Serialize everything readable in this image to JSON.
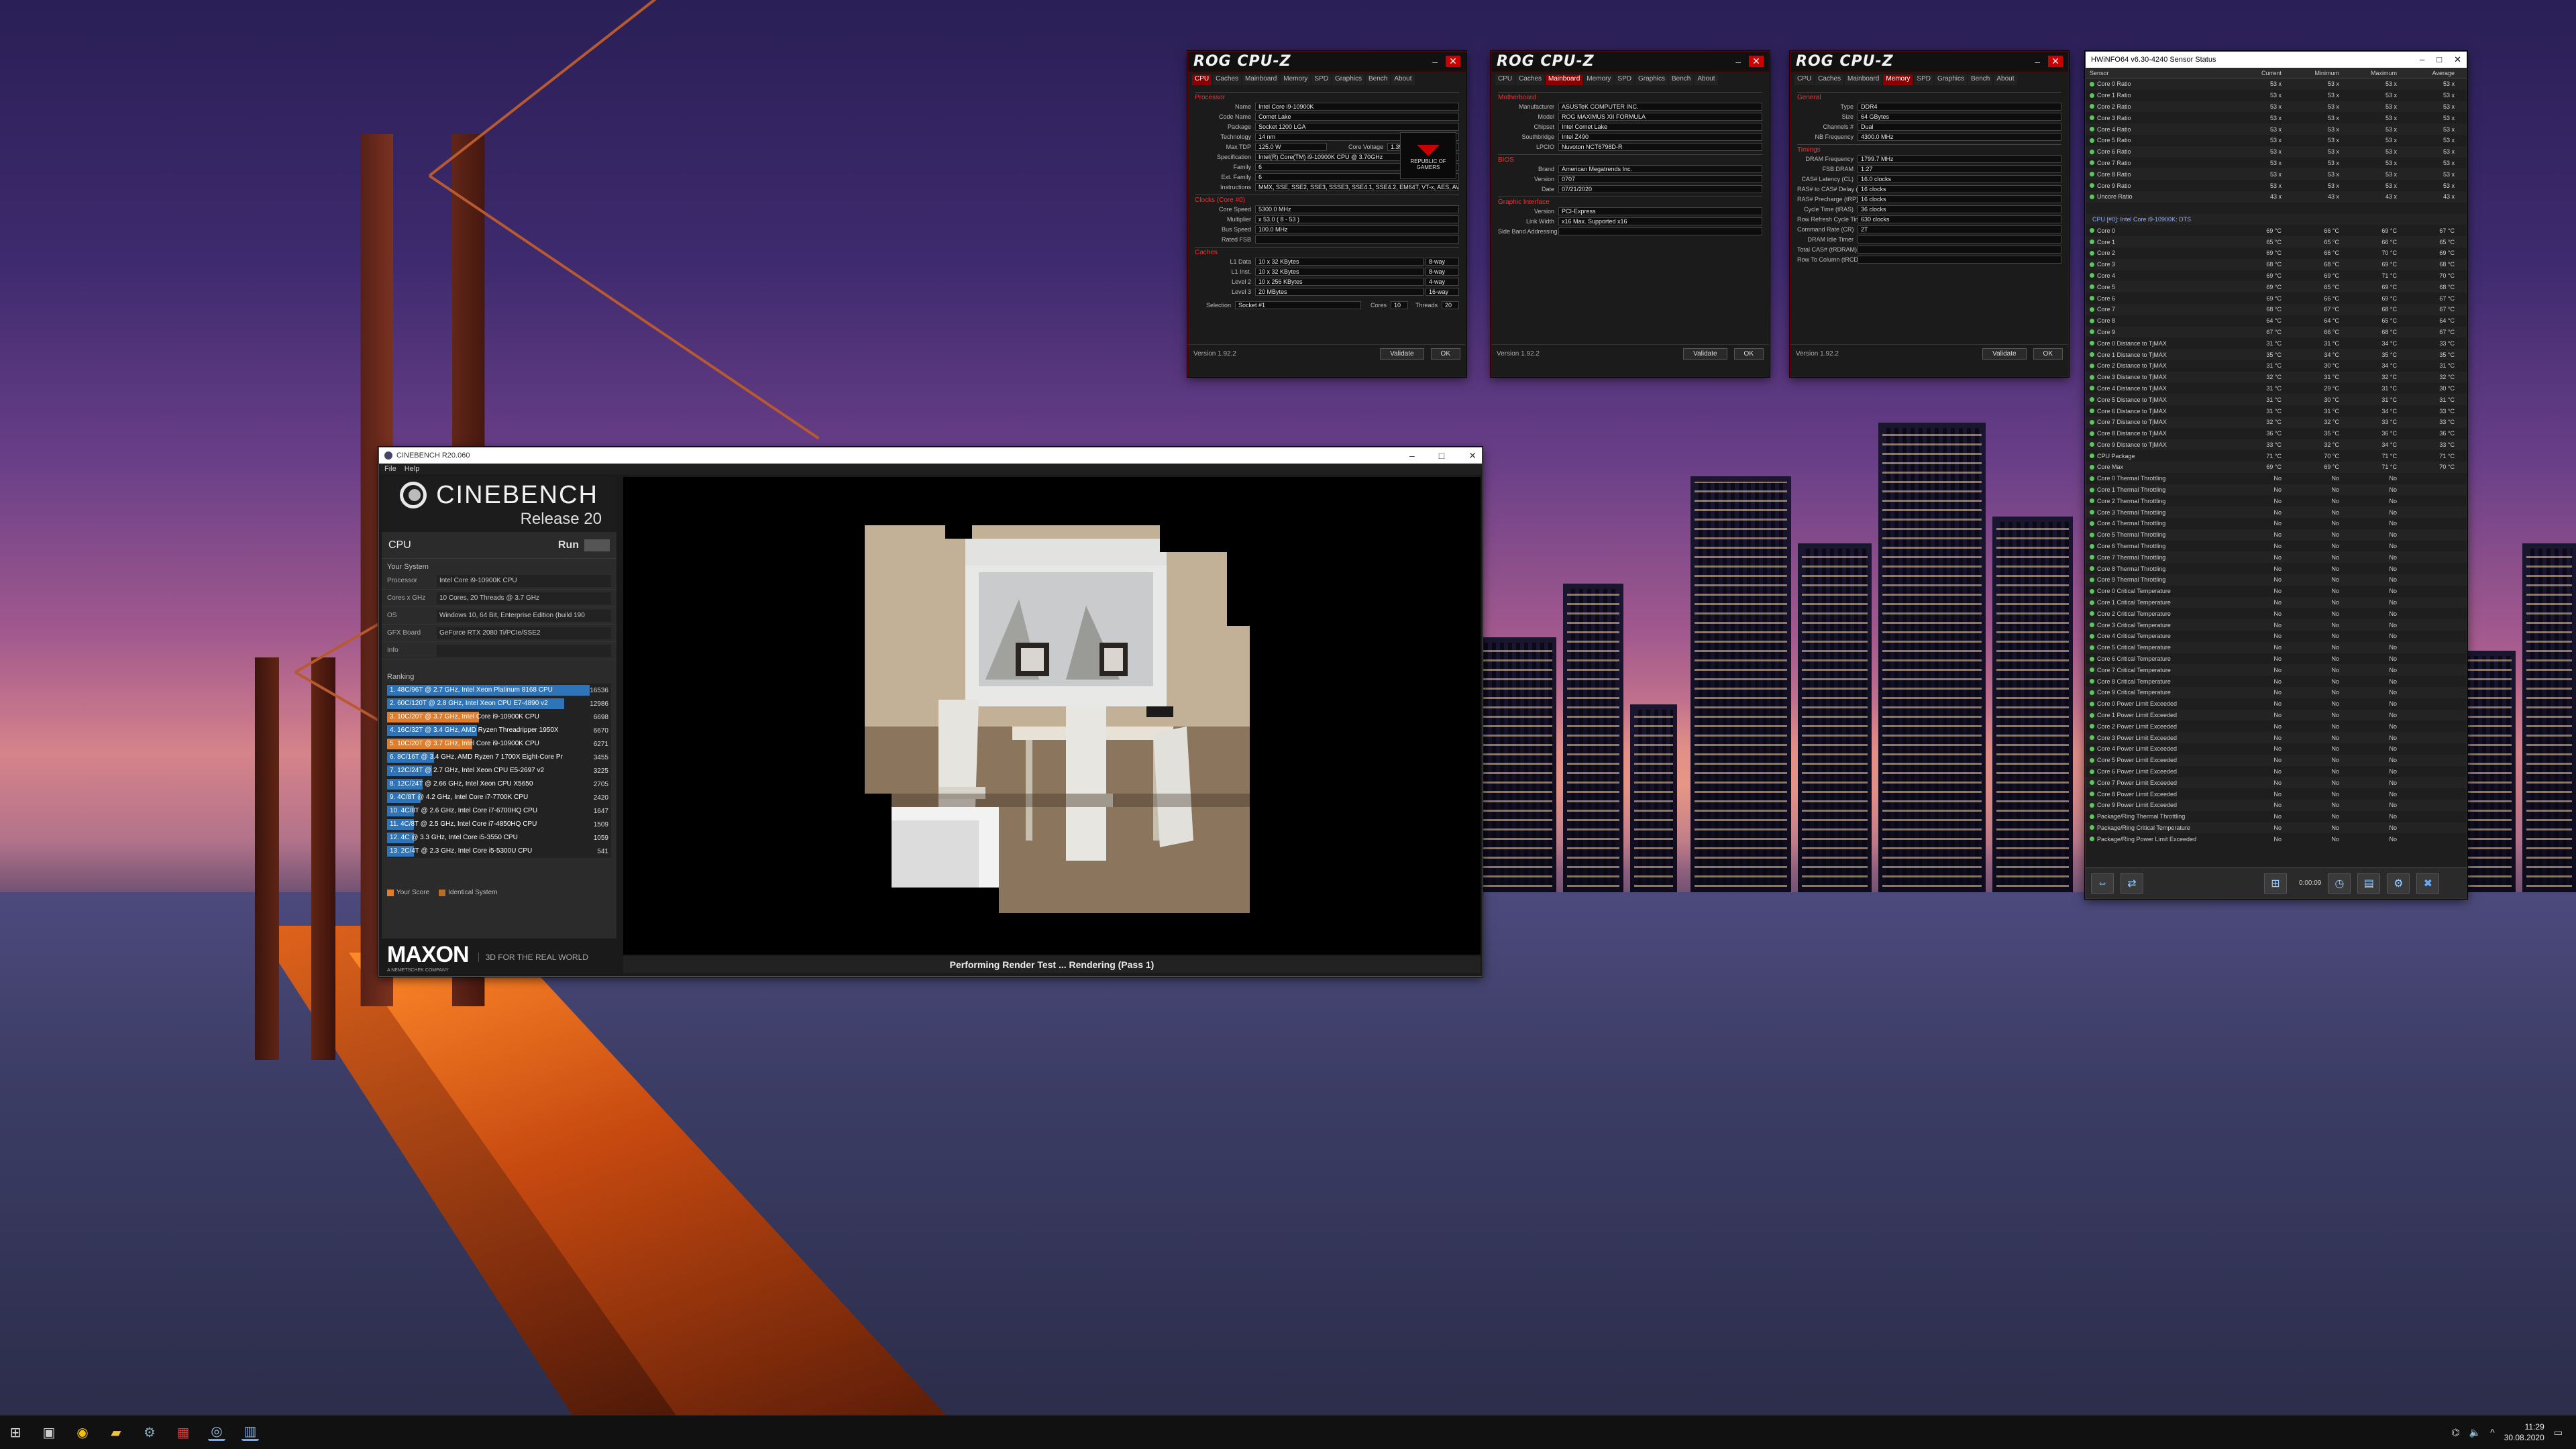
{
  "cpuz_windows": [
    {
      "logo": "ROG CPU-Z",
      "active_tab": "CPU",
      "tabs": [
        "CPU",
        "Caches",
        "Mainboard",
        "Memory",
        "SPD",
        "Graphics",
        "Bench",
        "About"
      ],
      "sections": [
        {
          "title": "Processor",
          "rows": [
            [
              "Name",
              "Intel Core i9-10900K"
            ],
            [
              "Code Name",
              "Comet Lake"
            ],
            [
              "Package",
              "Socket 1200 LGA"
            ],
            [
              "Technology",
              "14 nm"
            ],
            [
              "Specification",
              "Intel(R) Core(TM) i9-10900K CPU @ 3.70GHz"
            ],
            [
              "Family",
              "6"
            ],
            [
              "Ext. Family",
              "6"
            ],
            [
              "Instructions",
              "MMX, SSE, SSE2, SSE3, SSSE3, SSE4.1, SSE4.2, EM64T, VT-x, AES, AVX, AVX2, FMA3"
            ]
          ]
        },
        {
          "title": "Clocks (Core #0)",
          "rows": [
            [
              "Core Speed",
              "5300.0 MHz"
            ],
            [
              "Multiplier",
              "x 53.0 ( 8 - 53 )"
            ],
            [
              "Bus Speed",
              "100.0 MHz"
            ],
            [
              "Rated FSB",
              ""
            ]
          ]
        }
      ],
      "extra": {
        "max_tdp_label": "Max TDP",
        "max_tdp": "125.0 W",
        "core_voltage_label": "Core Voltage",
        "core_voltage": "1.352 V",
        "cache_label": "Caches",
        "cache_rows": [
          [
            "L1 Data",
            "10 x 32 KBytes",
            "8-way"
          ],
          [
            "L1 Inst.",
            "10 x 32 KBytes",
            "8-way"
          ],
          [
            "Level 2",
            "10 x 256 KBytes",
            "4-way"
          ],
          [
            "Level 3",
            "20 MBytes",
            "16-way"
          ]
        ],
        "selection_label": "Selection",
        "selection": "Socket #1",
        "cores_label": "Cores",
        "cores": "10",
        "threads_label": "Threads",
        "threads": "20",
        "badge": "REPUBLIC OF GAMERS"
      },
      "version": "Version 1.92.2",
      "validate": "Validate",
      "ok": "OK"
    },
    {
      "logo": "ROG CPU-Z",
      "active_tab": "Mainboard",
      "tabs": [
        "CPU",
        "Caches",
        "Mainboard",
        "Memory",
        "SPD",
        "Graphics",
        "Bench",
        "About"
      ],
      "sections": [
        {
          "title": "Motherboard",
          "rows": [
            [
              "Manufacturer",
              "ASUSTeK COMPUTER INC."
            ],
            [
              "Model",
              "ROG MAXIMUS XII FORMULA"
            ],
            [
              "Chipset",
              "Intel  Comet Lake"
            ],
            [
              "Southbridge",
              "Intel  Z490"
            ],
            [
              "LPCIO",
              "Nuvoton  NCT6798D-R"
            ]
          ]
        },
        {
          "title": "BIOS",
          "rows": [
            [
              "Brand",
              "American Megatrends Inc."
            ],
            [
              "Version",
              "0707"
            ],
            [
              "Date",
              "07/21/2020"
            ]
          ]
        },
        {
          "title": "Graphic Interface",
          "rows": [
            [
              "Version",
              "PCI-Express"
            ],
            [
              "Link Width",
              "x16   Max. Supported  x16"
            ],
            [
              "Side Band Addressing",
              ""
            ]
          ]
        }
      ],
      "version": "Version 1.92.2",
      "validate": "Validate",
      "ok": "OK"
    },
    {
      "logo": "ROG CPU-Z",
      "active_tab": "Memory",
      "tabs": [
        "CPU",
        "Caches",
        "Mainboard",
        "Memory",
        "SPD",
        "Graphics",
        "Bench",
        "About"
      ],
      "sections": [
        {
          "title": "General",
          "rows": [
            [
              "Type",
              "DDR4"
            ],
            [
              "Size",
              "64 GBytes"
            ],
            [
              "Channels #",
              "Dual"
            ],
            [
              "NB Frequency",
              "4300.0 MHz"
            ]
          ]
        },
        {
          "title": "Timings",
          "rows": [
            [
              "DRAM Frequency",
              "1799.7 MHz"
            ],
            [
              "FSB:DRAM",
              "1:27"
            ],
            [
              "CAS# Latency (CL)",
              "16.0 clocks"
            ],
            [
              "RAS# to CAS# Delay (tRCD)",
              "16 clocks"
            ],
            [
              "RAS# Precharge (tRP)",
              "16 clocks"
            ],
            [
              "Cycle Time (tRAS)",
              "36 clocks"
            ],
            [
              "Row Refresh Cycle Time (tRFC)",
              "630 clocks"
            ],
            [
              "Command Rate (CR)",
              "2T"
            ],
            [
              "DRAM Idle Timer",
              ""
            ],
            [
              "Total CAS# (tRDRAM)",
              ""
            ],
            [
              "Row To Column (tRCD)",
              ""
            ]
          ]
        }
      ],
      "version": "Version 1.92.2",
      "validate": "Validate",
      "ok": "OK"
    }
  ],
  "hwinfo": {
    "title": "HWiNFO64 v6.30-4240 Sensor Status",
    "columns": [
      "Sensor",
      "Current",
      "Minimum",
      "Maximum",
      "Average"
    ],
    "group_label": "CPU [#0]: Intel Core i9-10900K: DTS",
    "ratios": [
      [
        "Core 0 Ratio",
        "53 x",
        "53 x",
        "53 x",
        "53 x"
      ],
      [
        "Core 1 Ratio",
        "53 x",
        "53 x",
        "53 x",
        "53 x"
      ],
      [
        "Core 2 Ratio",
        "53 x",
        "53 x",
        "53 x",
        "53 x"
      ],
      [
        "Core 3 Ratio",
        "53 x",
        "53 x",
        "53 x",
        "53 x"
      ],
      [
        "Core 4 Ratio",
        "53 x",
        "53 x",
        "53 x",
        "53 x"
      ],
      [
        "Core 5 Ratio",
        "53 x",
        "53 x",
        "53 x",
        "53 x"
      ],
      [
        "Core 6 Ratio",
        "53 x",
        "53 x",
        "53 x",
        "53 x"
      ],
      [
        "Core 7 Ratio",
        "53 x",
        "53 x",
        "53 x",
        "53 x"
      ],
      [
        "Core 8 Ratio",
        "53 x",
        "53 x",
        "53 x",
        "53 x"
      ],
      [
        "Core 9 Ratio",
        "53 x",
        "53 x",
        "53 x",
        "53 x"
      ],
      [
        "Uncore Ratio",
        "43 x",
        "43 x",
        "43 x",
        "43 x"
      ]
    ],
    "temps": [
      [
        "Core 0",
        "69 °C",
        "66 °C",
        "69 °C",
        "67 °C"
      ],
      [
        "Core 1",
        "65 °C",
        "65 °C",
        "66 °C",
        "65 °C"
      ],
      [
        "Core 2",
        "69 °C",
        "66 °C",
        "70 °C",
        "69 °C"
      ],
      [
        "Core 3",
        "68 °C",
        "68 °C",
        "69 °C",
        "68 °C"
      ],
      [
        "Core 4",
        "69 °C",
        "69 °C",
        "71 °C",
        "70 °C"
      ],
      [
        "Core 5",
        "69 °C",
        "65 °C",
        "69 °C",
        "68 °C"
      ],
      [
        "Core 6",
        "69 °C",
        "66 °C",
        "69 °C",
        "67 °C"
      ],
      [
        "Core 7",
        "68 °C",
        "67 °C",
        "68 °C",
        "67 °C"
      ],
      [
        "Core 8",
        "64 °C",
        "64 °C",
        "65 °C",
        "64 °C"
      ],
      [
        "Core 9",
        "67 °C",
        "66 °C",
        "68 °C",
        "67 °C"
      ],
      [
        "Core 0 Distance to TjMAX",
        "31 °C",
        "31 °C",
        "34 °C",
        "33 °C"
      ],
      [
        "Core 1 Distance to TjMAX",
        "35 °C",
        "34 °C",
        "35 °C",
        "35 °C"
      ],
      [
        "Core 2 Distance to TjMAX",
        "31 °C",
        "30 °C",
        "34 °C",
        "31 °C"
      ],
      [
        "Core 3 Distance to TjMAX",
        "32 °C",
        "31 °C",
        "32 °C",
        "32 °C"
      ],
      [
        "Core 4 Distance to TjMAX",
        "31 °C",
        "29 °C",
        "31 °C",
        "30 °C"
      ],
      [
        "Core 5 Distance to TjMAX",
        "31 °C",
        "30 °C",
        "31 °C",
        "31 °C"
      ],
      [
        "Core 6 Distance to TjMAX",
        "31 °C",
        "31 °C",
        "34 °C",
        "33 °C"
      ],
      [
        "Core 7 Distance to TjMAX",
        "32 °C",
        "32 °C",
        "33 °C",
        "33 °C"
      ],
      [
        "Core 8 Distance to TjMAX",
        "36 °C",
        "35 °C",
        "36 °C",
        "36 °C"
      ],
      [
        "Core 9 Distance to TjMAX",
        "33 °C",
        "32 °C",
        "34 °C",
        "33 °C"
      ],
      [
        "CPU Package",
        "71 °C",
        "70 °C",
        "71 °C",
        "71 °C"
      ],
      [
        "Core Max",
        "69 °C",
        "69 °C",
        "71 °C",
        "70 °C"
      ]
    ],
    "flags": [
      [
        "Core 0 Thermal Throttling",
        "No",
        "No",
        "No"
      ],
      [
        "Core 1 Thermal Throttling",
        "No",
        "No",
        "No"
      ],
      [
        "Core 2 Thermal Throttling",
        "No",
        "No",
        "No"
      ],
      [
        "Core 3 Thermal Throttling",
        "No",
        "No",
        "No"
      ],
      [
        "Core 4 Thermal Throttling",
        "No",
        "No",
        "No"
      ],
      [
        "Core 5 Thermal Throttling",
        "No",
        "No",
        "No"
      ],
      [
        "Core 6 Thermal Throttling",
        "No",
        "No",
        "No"
      ],
      [
        "Core 7 Thermal Throttling",
        "No",
        "No",
        "No"
      ],
      [
        "Core 8 Thermal Throttling",
        "No",
        "No",
        "No"
      ],
      [
        "Core 9 Thermal Throttling",
        "No",
        "No",
        "No"
      ],
      [
        "Core 0 Critical Temperature",
        "No",
        "No",
        "No"
      ],
      [
        "Core 1 Critical Temperature",
        "No",
        "No",
        "No"
      ],
      [
        "Core 2 Critical Temperature",
        "No",
        "No",
        "No"
      ],
      [
        "Core 3 Critical Temperature",
        "No",
        "No",
        "No"
      ],
      [
        "Core 4 Critical Temperature",
        "No",
        "No",
        "No"
      ],
      [
        "Core 5 Critical Temperature",
        "No",
        "No",
        "No"
      ],
      [
        "Core 6 Critical Temperature",
        "No",
        "No",
        "No"
      ],
      [
        "Core 7 Critical Temperature",
        "No",
        "No",
        "No"
      ],
      [
        "Core 8 Critical Temperature",
        "No",
        "No",
        "No"
      ],
      [
        "Core 9 Critical Temperature",
        "No",
        "No",
        "No"
      ],
      [
        "Core 0 Power Limit Exceeded",
        "No",
        "No",
        "No"
      ],
      [
        "Core 1 Power Limit Exceeded",
        "No",
        "No",
        "No"
      ],
      [
        "Core 2 Power Limit Exceeded",
        "No",
        "No",
        "No"
      ],
      [
        "Core 3 Power Limit Exceeded",
        "No",
        "No",
        "No"
      ],
      [
        "Core 4 Power Limit Exceeded",
        "No",
        "No",
        "No"
      ],
      [
        "Core 5 Power Limit Exceeded",
        "No",
        "No",
        "No"
      ],
      [
        "Core 6 Power Limit Exceeded",
        "No",
        "No",
        "No"
      ],
      [
        "Core 7 Power Limit Exceeded",
        "No",
        "No",
        "No"
      ],
      [
        "Core 8 Power Limit Exceeded",
        "No",
        "No",
        "No"
      ],
      [
        "Core 9 Power Limit Exceeded",
        "No",
        "No",
        "No"
      ],
      [
        "Package/Ring Thermal Throttling",
        "No",
        "No",
        "No"
      ],
      [
        "Package/Ring Critical Temperature",
        "No",
        "No",
        "No"
      ],
      [
        "Package/Ring Power Limit Exceeded",
        "No",
        "No",
        "No"
      ]
    ],
    "timer": "0:00:09"
  },
  "cinebench": {
    "title": "CINEBENCH R20.060",
    "menu": [
      "File",
      "Help"
    ],
    "brand": "CINEBENCH",
    "release": "Release 20",
    "cpu_label": "CPU",
    "run_label": "Run",
    "system_header": "Your System",
    "system": [
      [
        "Processor",
        "Intel Core i9-10900K CPU"
      ],
      [
        "Cores x GHz",
        "10 Cores, 20 Threads @ 3.7 GHz"
      ],
      [
        "OS",
        "Windows 10, 64 Bit, Enterprise Edition (build 190"
      ],
      [
        "GFX Board",
        "GeForce RTX 2080 Ti/PCIe/SSE2"
      ],
      [
        "Info",
        ""
      ]
    ],
    "ranking_header": "Ranking",
    "ranking": [
      {
        "label": "1. 48C/96T @ 2.7 GHz, Intel Xeon Platinum 8168 CPU",
        "score": 16536,
        "kind": "ref"
      },
      {
        "label": "2. 60C/120T @ 2.8 GHz, Intel Xeon CPU E7-4890 v2",
        "score": 12986,
        "kind": "ref"
      },
      {
        "label": "3. 10C/20T @ 3.7 GHz, Intel Core i9-10900K CPU",
        "score": 6698,
        "kind": "mine"
      },
      {
        "label": "4. 16C/32T @ 3.4 GHz, AMD Ryzen Threadripper 1950X",
        "score": 6670,
        "kind": "ref"
      },
      {
        "label": "5. 10C/20T @ 3.7 GHz, Intel Core i9-10900K CPU",
        "score": 6271,
        "kind": "mine"
      },
      {
        "label": "6. 8C/16T @ 3.4 GHz, AMD Ryzen 7 1700X Eight-Core Pr",
        "score": 3455,
        "kind": "ref"
      },
      {
        "label": "7. 12C/24T @ 2.7 GHz, Intel Xeon CPU E5-2697 v2",
        "score": 3225,
        "kind": "ref"
      },
      {
        "label": "8. 12C/24T @ 2.66 GHz, Intel Xeon CPU X5650",
        "score": 2705,
        "kind": "ref"
      },
      {
        "label": "9. 4C/8T @ 4.2 GHz, Intel Core i7-7700K CPU",
        "score": 2420,
        "kind": "ref"
      },
      {
        "label": "10. 4C/8T @ 2.6 GHz, Intel Core i7-6700HQ CPU",
        "score": 1647,
        "kind": "ref"
      },
      {
        "label": "11. 4C/8T @ 2.5 GHz, Intel Core i7-4850HQ CPU",
        "score": 1509,
        "kind": "ref"
      },
      {
        "label": "12. 4C @ 3.3 GHz, Intel Core i5-3550 CPU",
        "score": 1059,
        "kind": "ref"
      },
      {
        "label": "13. 2C/4T @ 2.3 GHz, Intel Core i5-5300U CPU",
        "score": 541,
        "kind": "ref"
      }
    ],
    "legend_your": "Your Score",
    "legend_ident": "Identical System",
    "maxon": "MAXON",
    "maxon_sub": "A NEMETSCHEK COMPANY",
    "tagline": "3D FOR THE REAL WORLD",
    "status": "Performing Render Test ... Rendering (Pass 1)",
    "colors": {
      "mine": "#e07d2a",
      "ref": "#2d74b8"
    }
  },
  "taskbar": {
    "time": "11:29",
    "date": "30.08.2020"
  }
}
